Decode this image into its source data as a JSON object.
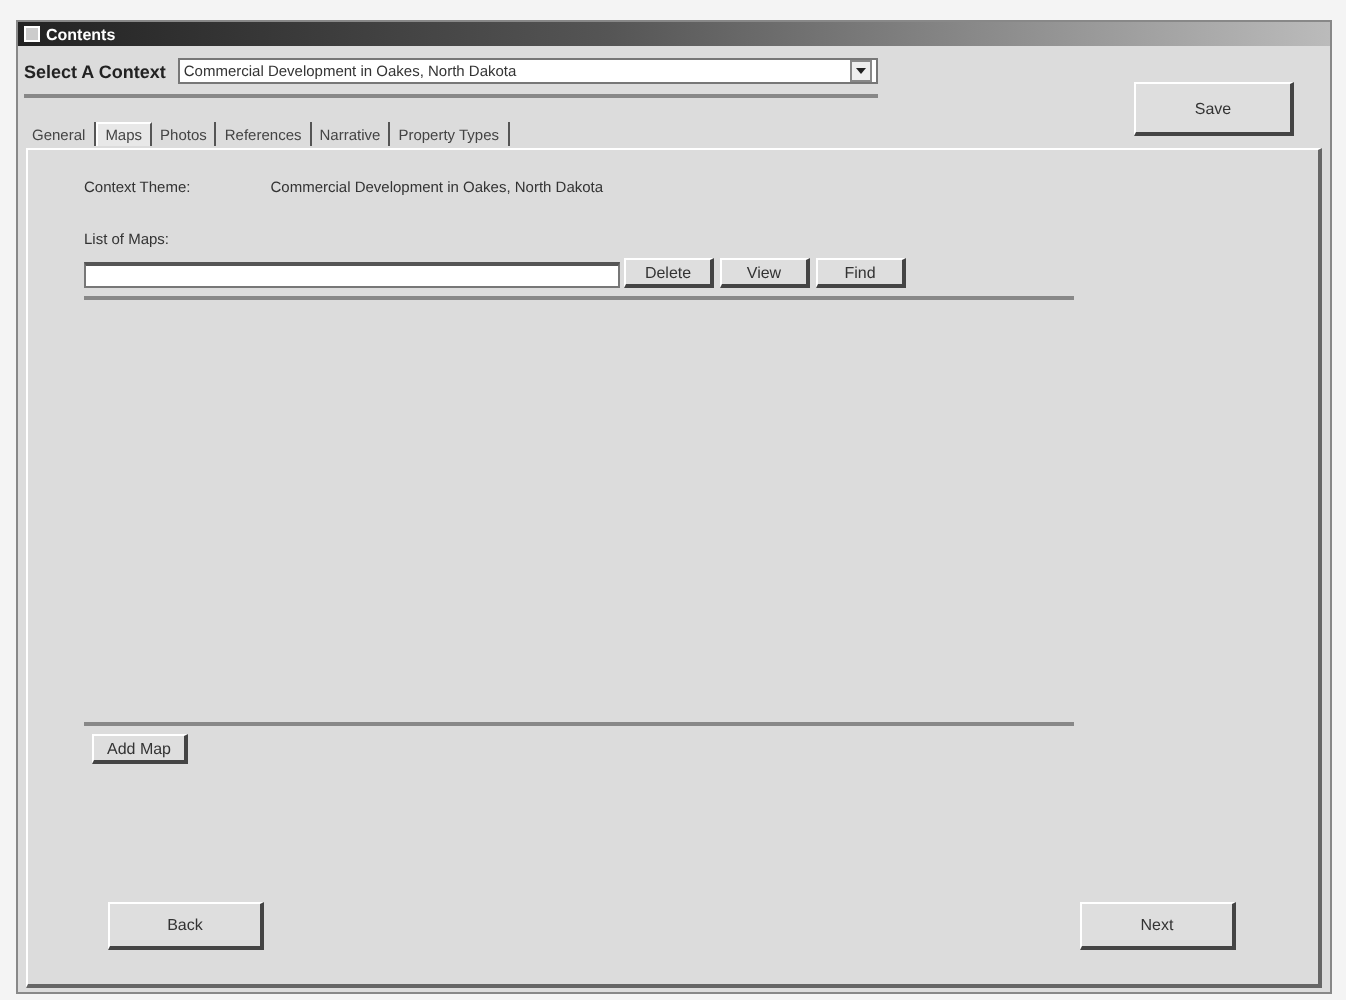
{
  "window": {
    "title": "Contents"
  },
  "context": {
    "label": "Select A Context",
    "value": "Commercial Development in Oakes, North Dakota"
  },
  "save_button": "Save",
  "tabs": [
    {
      "label": "General",
      "selected": false
    },
    {
      "label": "Maps",
      "selected": true
    },
    {
      "label": "Photos",
      "selected": false
    },
    {
      "label": "References",
      "selected": false
    },
    {
      "label": "Narrative",
      "selected": false
    },
    {
      "label": "Property Types",
      "selected": false
    }
  ],
  "theme": {
    "label": "Context Theme:",
    "value": "Commercial Development in Oakes, North Dakota"
  },
  "maps": {
    "label": "List of Maps:",
    "buttons": [
      "Delete",
      "View",
      "Find"
    ],
    "add_button": "Add Map"
  },
  "nav": {
    "back": "Back",
    "next": "Next"
  }
}
